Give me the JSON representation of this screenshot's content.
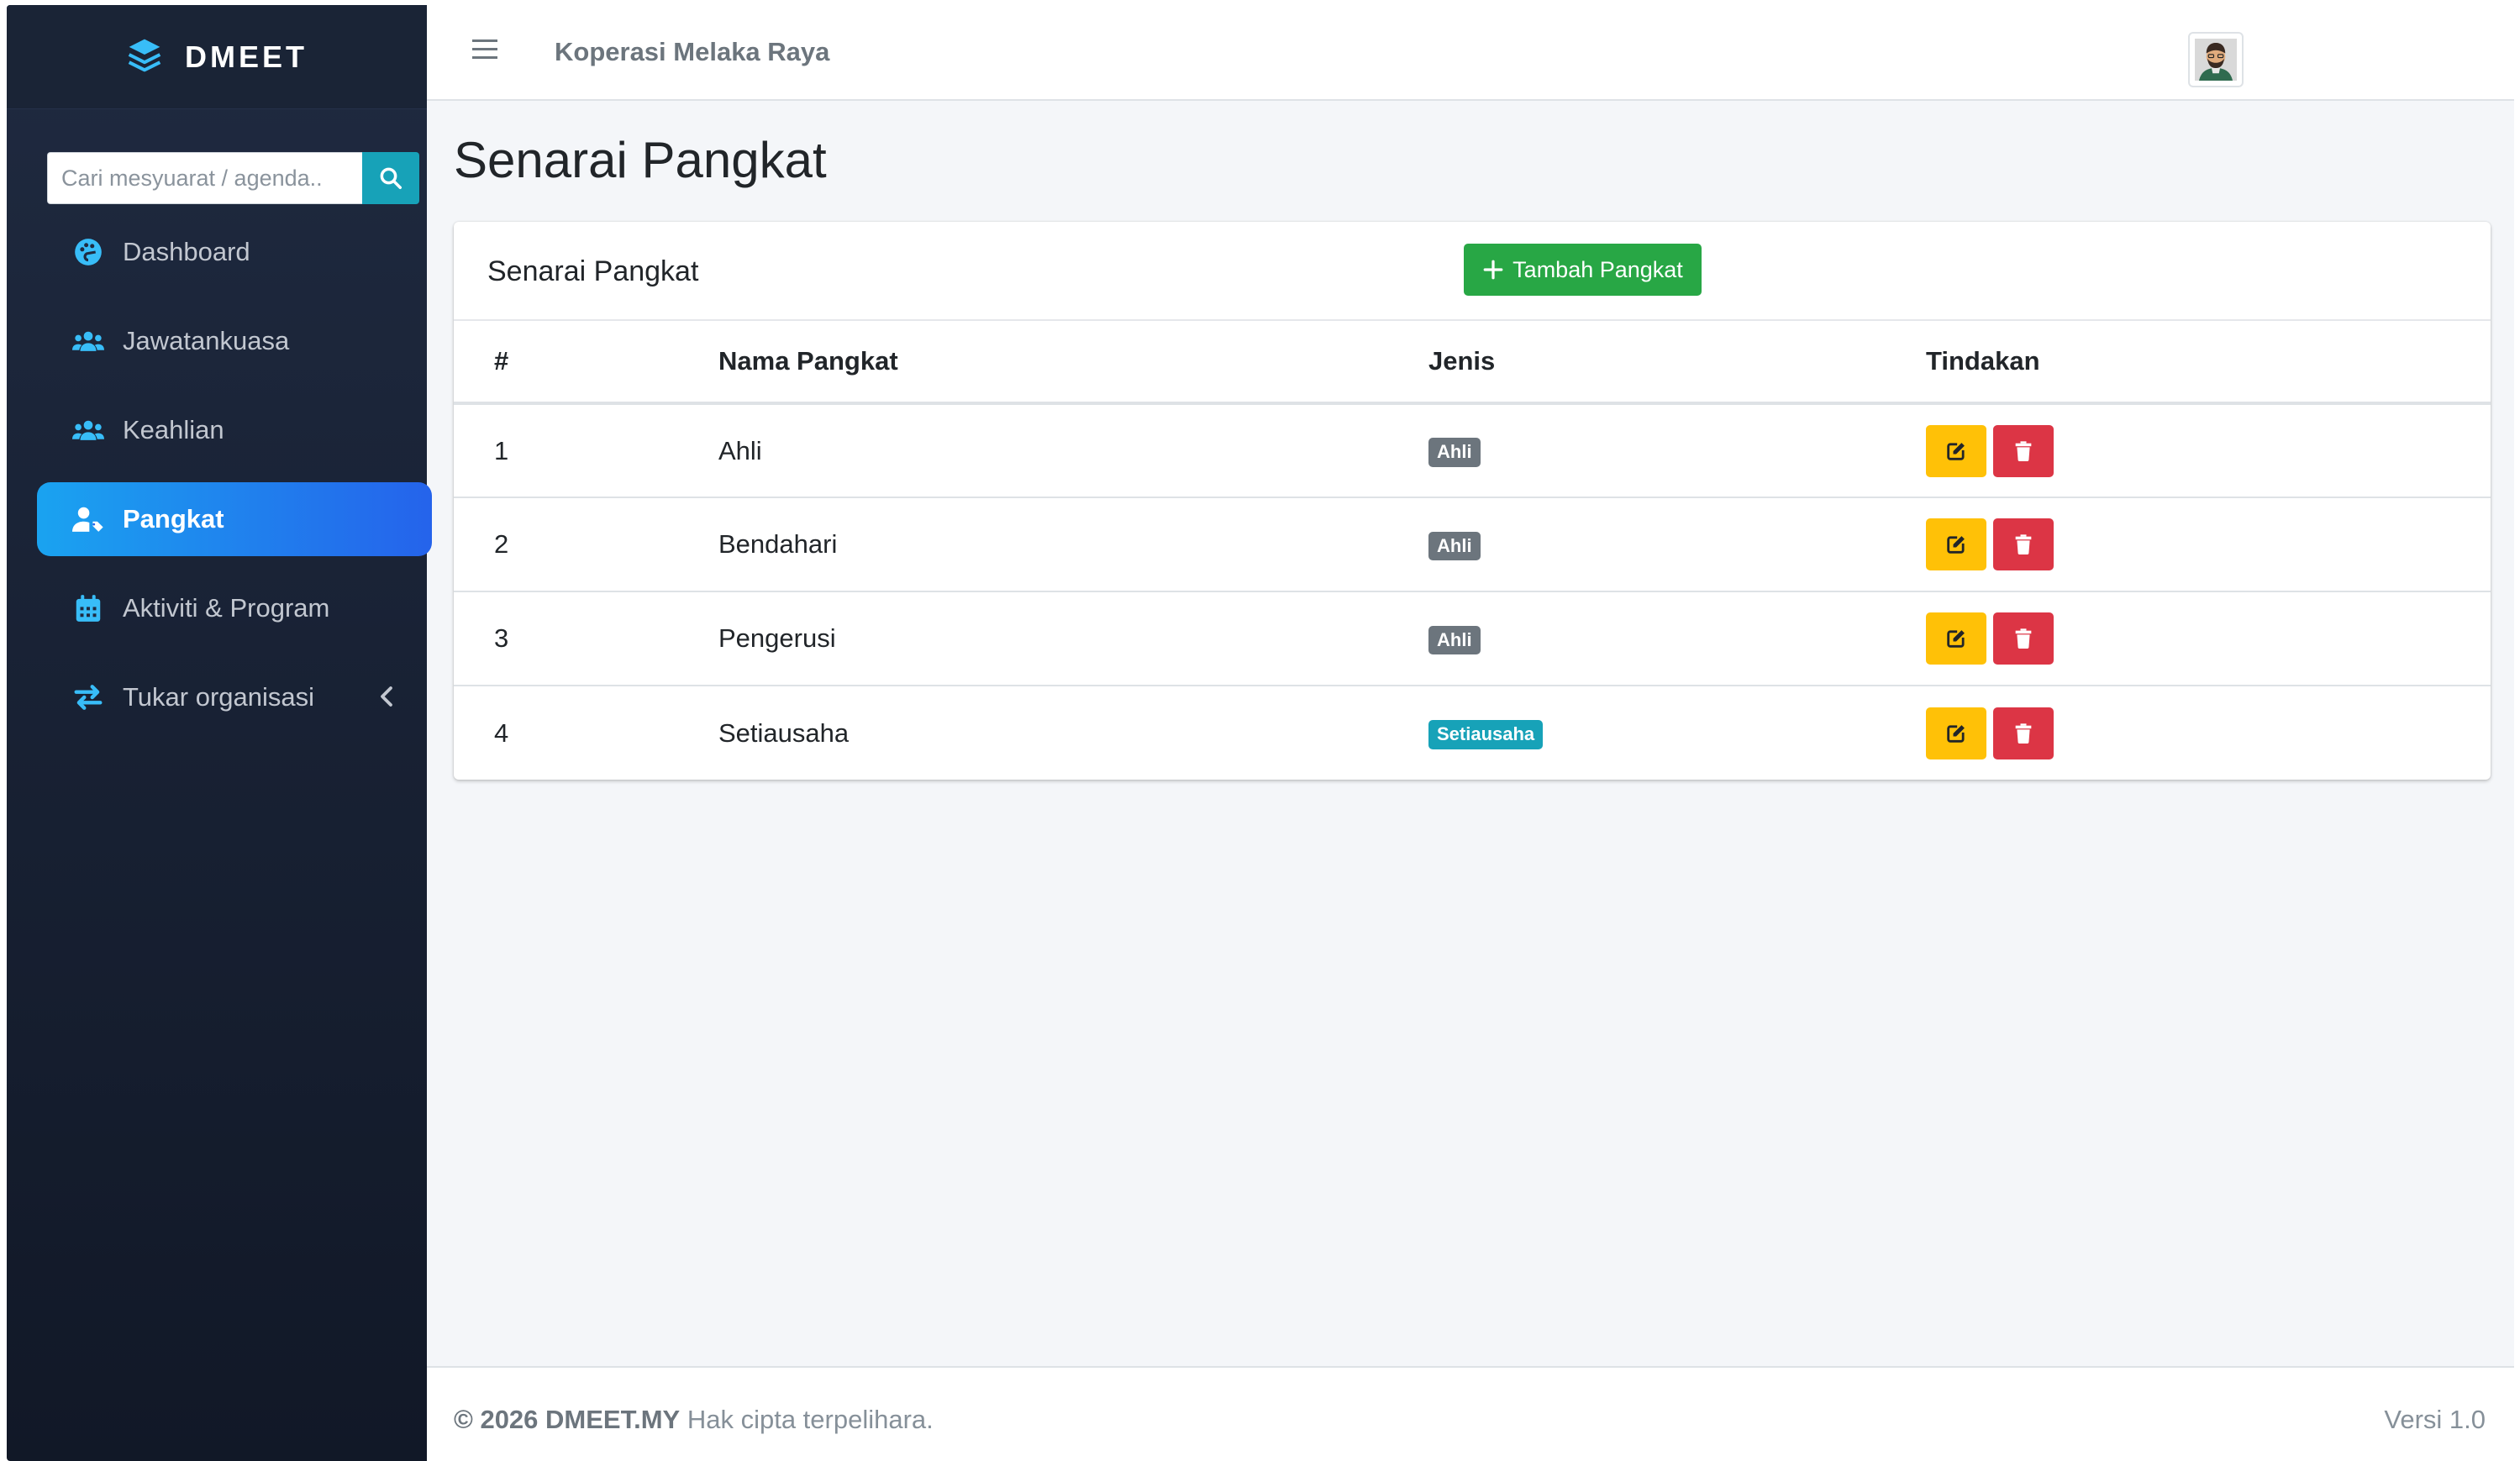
{
  "brand": {
    "name": "DMEET",
    "icon": "layers-icon"
  },
  "search": {
    "placeholder": "Cari mesyuarat / agenda.."
  },
  "sidebar": {
    "items": [
      {
        "label": "Dashboard",
        "icon": "palette-icon"
      },
      {
        "label": "Jawatankuasa",
        "icon": "users-icon"
      },
      {
        "label": "Keahlian",
        "icon": "users-icon"
      },
      {
        "label": "Pangkat",
        "icon": "user-tag-icon",
        "active": true
      },
      {
        "label": "Aktiviti & Program",
        "icon": "calendar-icon"
      },
      {
        "label": "Tukar organisasi",
        "icon": "exchange-icon"
      }
    ]
  },
  "topbar": {
    "org_name": "Koperasi Melaka Raya"
  },
  "page": {
    "title": "Senarai Pangkat"
  },
  "card": {
    "title": "Senarai Pangkat",
    "add_button": "Tambah Pangkat",
    "columns": [
      "#",
      "Nama Pangkat",
      "Jenis",
      "Tindakan"
    ],
    "rows": [
      {
        "no": "1",
        "name": "Ahli",
        "type": "Ahli"
      },
      {
        "no": "2",
        "name": "Bendahari",
        "type": "Ahli"
      },
      {
        "no": "3",
        "name": "Pengerusi",
        "type": "Ahli"
      },
      {
        "no": "4",
        "name": "Setiausaha",
        "type": "Setiausaha"
      }
    ]
  },
  "footer": {
    "copyright": "© 2026 DMEET.MY",
    "rights": "Hak cipta terpelihara.",
    "version": "Versi 1.0"
  },
  "colors": {
    "sidebar_bg": "#1f2a40",
    "active_gradient_start": "#1aa3f0",
    "active_gradient_end": "#2563eb",
    "icon_accent": "#38bdf8",
    "success": "#28a745",
    "warning": "#ffc107",
    "danger": "#dc3545",
    "info": "#17a2b8",
    "secondary": "#6c757d"
  }
}
